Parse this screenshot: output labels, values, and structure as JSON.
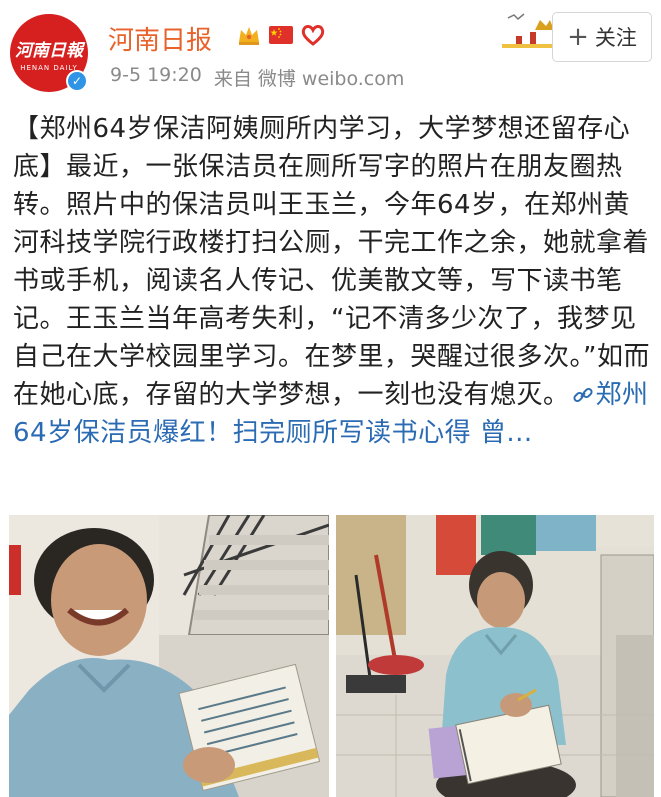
{
  "account": {
    "name": "河南日报",
    "avatar_text_cn": "河南日報",
    "avatar_text_en": "HENAN DAILY",
    "verified_icon": "verified-check-icon"
  },
  "meta": {
    "time": "9-5 19:20",
    "source": "来自 微博 weibo.com"
  },
  "follow": {
    "plus": "+",
    "label": "关注"
  },
  "post": {
    "text": "【郑州64岁保洁阿姨厕所内学习，大学梦想还留存心底】最近，一张保洁员在厕所写字的照片在朋友圈热转。照片中的保洁员叫王玉兰，今年64岁，在郑州黄河科技学院行政楼打扫公厕，干完工作之余，她就拿着书或手机，阅读名人传记、优美散文等，写下读书笔记。王玉兰当年高考失利，“记不清多少次了，我梦见自己在大学校园里学习。在梦里，哭醒过很多次。”如而在她心底，存留的大学梦想，一刻也没有熄灭。",
    "link_icon": "link-icon",
    "link_text": "郑州64岁保洁员爆红！扫完厕所写读书心得 曾...",
    "more": ""
  },
  "colors": {
    "brand_orange": "#e8632c",
    "link_blue": "#2b6bb3",
    "meta_gray": "#8a8a8a",
    "avatar_red": "#d61f1f"
  },
  "photos": [
    {
      "name": "photo-cleaner-smiling"
    },
    {
      "name": "photo-cleaner-writing"
    }
  ]
}
